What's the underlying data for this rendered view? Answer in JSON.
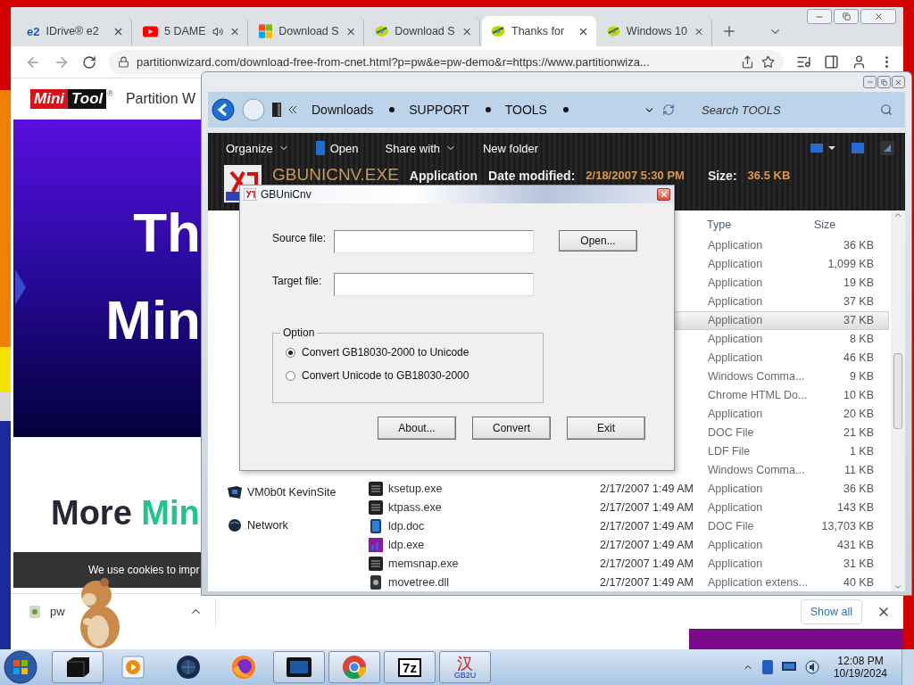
{
  "browser": {
    "tabs": [
      {
        "kind": "text",
        "icon_text": "e2",
        "title": "IDrive® e2",
        "audio": false,
        "selected": false
      },
      {
        "kind": "video",
        "title": "5 DAME",
        "audio": true,
        "selected": false
      },
      {
        "kind": "windows",
        "title": "Download S",
        "audio": false,
        "selected": false
      },
      {
        "kind": "disk",
        "title": "Download S",
        "audio": false,
        "selected": false
      },
      {
        "kind": "disk",
        "title": "Thanks for",
        "audio": false,
        "selected": true
      },
      {
        "kind": "disk",
        "title": "Windows 10",
        "audio": false,
        "selected": false
      }
    ],
    "address": "partitionwizard.com/download-free-from-cnet.html?p=pw&e=pw-demo&r=https://www.partitionwiza...",
    "page": {
      "logo_left": "Mini",
      "logo_right": "Tool",
      "logo_mark": "®",
      "product": "Partition W",
      "hero_lines": [
        "Th",
        "Min"
      ],
      "section_title": {
        "text": "More ",
        "highlight": "Min"
      },
      "cookie_notice": "We use cookies to impr"
    },
    "download_bar": {
      "file": "pw",
      "show_all": "Show all"
    }
  },
  "explorer": {
    "breadcrumbs": [
      "Downloads",
      "SUPPORT",
      "TOOLS"
    ],
    "search_placeholder": "Search TOOLS",
    "toolbar": [
      {
        "label": "Organize",
        "dropdown": true,
        "kind": "menu"
      },
      {
        "label": "Open",
        "dropdown": false,
        "kind": "open"
      },
      {
        "label": "Share with",
        "dropdown": true,
        "kind": "menu"
      },
      {
        "label": "New folder",
        "dropdown": false,
        "kind": "menu"
      }
    ],
    "details": {
      "name": "GBUNICNV.EXE",
      "type": "Application",
      "modified_label": "Date modified:",
      "modified": "2/18/2007 5:30 PM",
      "size_label": "Size:",
      "size": "36.5 KB"
    },
    "nav": [
      {
        "label": "VM0b0t KevinSite",
        "kind": "drive"
      },
      {
        "label": "Network",
        "kind": "network"
      }
    ],
    "columns": [
      "Type",
      "Size"
    ],
    "files": [
      {
        "type": "Application",
        "size": "36 KB",
        "selected": false
      },
      {
        "type": "Application",
        "size": "1,099 KB",
        "selected": false
      },
      {
        "type": "Application",
        "size": "19 KB",
        "selected": false
      },
      {
        "type": "Application",
        "size": "37 KB",
        "selected": false
      },
      {
        "type": "Application",
        "size": "37 KB",
        "selected": true
      },
      {
        "type": "Application",
        "size": "8 KB",
        "selected": false
      },
      {
        "type": "Application",
        "size": "46 KB",
        "selected": false
      },
      {
        "type": "Windows Comma...",
        "size": "9 KB",
        "selected": false
      },
      {
        "type": "Chrome HTML Do...",
        "size": "10 KB",
        "selected": false
      },
      {
        "type": "Application",
        "size": "20 KB",
        "selected": false
      },
      {
        "type": "DOC File",
        "size": "21 KB",
        "selected": false
      },
      {
        "type": "LDF File",
        "size": "1 KB",
        "selected": false
      },
      {
        "type": "Windows Comma...",
        "size": "11 KB",
        "selected": false
      },
      {
        "name": "ksetup.exe",
        "kind": "exe",
        "date": "2/17/2007 1:49 AM",
        "type": "Application",
        "size": "36 KB",
        "selected": false
      },
      {
        "name": "ktpass.exe",
        "kind": "exe",
        "date": "2/17/2007 1:49 AM",
        "type": "Application",
        "size": "143 KB",
        "selected": false
      },
      {
        "name": "ldp.doc",
        "kind": "doc",
        "date": "2/17/2007 1:49 AM",
        "type": "DOC File",
        "size": "13,703 KB",
        "selected": false
      },
      {
        "name": "ldp.exe",
        "kind": "app",
        "date": "2/17/2007 1:49 AM",
        "type": "Application",
        "size": "431 KB",
        "selected": false
      },
      {
        "name": "memsnap.exe",
        "kind": "exe",
        "date": "2/17/2007 1:49 AM",
        "type": "Application",
        "size": "31 KB",
        "selected": false
      },
      {
        "name": "movetree.dll",
        "kind": "dll",
        "date": "2/17/2007 1:49 AM",
        "type": "Application extens...",
        "size": "40 KB",
        "selected": false
      }
    ]
  },
  "dialog": {
    "title": "GBUniCnv",
    "fields": [
      {
        "label": "Source file:"
      },
      {
        "label": "Target file:"
      }
    ],
    "open_button": "Open...",
    "option_group": {
      "title": "Option",
      "choices": [
        {
          "label": "Convert GB18030-2000 to Unicode",
          "selected": true
        },
        {
          "label": "Convert Unicode to GB18030-2000",
          "selected": false
        }
      ]
    },
    "buttons": [
      "About...",
      "Convert",
      "Exit"
    ]
  },
  "taskbar": {
    "apps": [
      {
        "kind": "explorer",
        "open": true
      },
      {
        "kind": "media",
        "open": false
      },
      {
        "kind": "globe",
        "open": false
      },
      {
        "kind": "firefox",
        "open": false
      },
      {
        "kind": "screen",
        "open": true
      },
      {
        "kind": "chrome",
        "open": true
      },
      {
        "kind": "sevenzip",
        "label": "7z",
        "open": true
      },
      {
        "kind": "gbu",
        "label": "汉",
        "sublabel": "GB2U",
        "open": true
      }
    ],
    "time": "12:08 PM",
    "date": "10/19/2024"
  }
}
